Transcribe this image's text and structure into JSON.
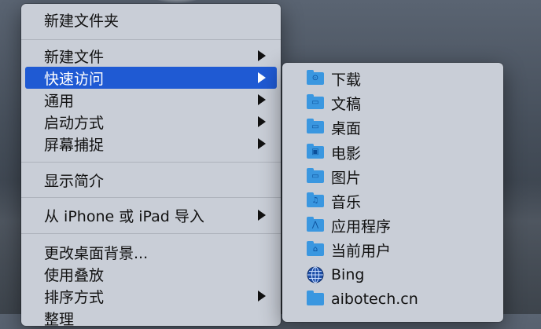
{
  "context_menu": {
    "items": [
      {
        "label": "新建文件夹",
        "has_submenu": false
      },
      {
        "label": "新建文件",
        "has_submenu": true
      },
      {
        "label": "快速访问",
        "has_submenu": true,
        "active": true
      },
      {
        "label": "通用",
        "has_submenu": true
      },
      {
        "label": "启动方式",
        "has_submenu": true
      },
      {
        "label": "屏幕捕捉",
        "has_submenu": true
      },
      {
        "label": "显示简介",
        "has_submenu": false
      },
      {
        "label": "从 iPhone 或 iPad 导入",
        "has_submenu": true
      },
      {
        "label": "更改桌面背景...",
        "has_submenu": false
      },
      {
        "label": "使用叠放",
        "has_submenu": false
      },
      {
        "label": "排序方式",
        "has_submenu": true
      },
      {
        "label": "整理",
        "has_submenu": false
      }
    ]
  },
  "quick_access_submenu": {
    "items": [
      {
        "label": "下载",
        "icon": "download-folder-icon"
      },
      {
        "label": "文稿",
        "icon": "documents-folder-icon"
      },
      {
        "label": "桌面",
        "icon": "desktop-folder-icon"
      },
      {
        "label": "电影",
        "icon": "movies-folder-icon"
      },
      {
        "label": "图片",
        "icon": "pictures-folder-icon"
      },
      {
        "label": "音乐",
        "icon": "music-folder-icon"
      },
      {
        "label": "应用程序",
        "icon": "applications-folder-icon"
      },
      {
        "label": "当前用户",
        "icon": "home-folder-icon"
      },
      {
        "label": "Bing",
        "icon": "globe-icon"
      },
      {
        "label": "aibotech.cn",
        "icon": "folder-icon"
      }
    ]
  },
  "colors": {
    "menu_background": "#c9ced7",
    "selection": "#1f5ad3",
    "folder_blue": "#3a97e0"
  }
}
